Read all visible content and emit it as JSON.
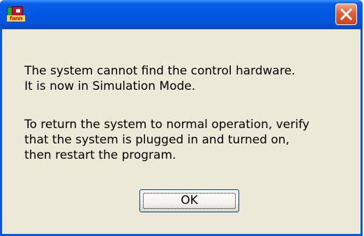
{
  "window": {
    "icon": "fann-app-icon",
    "icon_text": "fann",
    "close_icon": "close-icon",
    "accent": "#0058e6",
    "close_color": "#e2643c"
  },
  "message": {
    "paragraph1": [
      "The system cannot find the control hardware.",
      "It is now in Simulation Mode."
    ],
    "paragraph2": [
      "To return the system to normal operation, verify",
      "that the system is plugged in and turned on,",
      "then restart the program."
    ]
  },
  "buttons": {
    "ok_label": "OK"
  }
}
